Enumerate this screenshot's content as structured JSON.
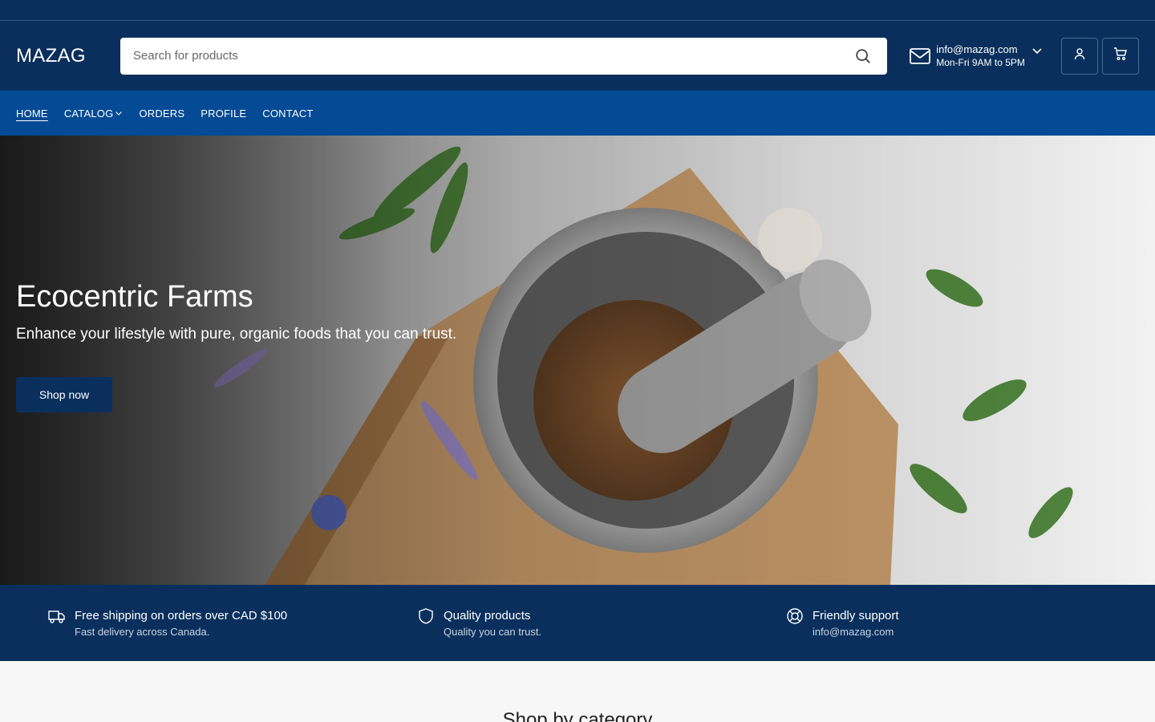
{
  "header": {
    "logo": "MAZAG",
    "search_placeholder": "Search for products",
    "contact_email": "info@mazag.com",
    "contact_hours": "Mon-Fri 9AM to 5PM"
  },
  "nav": {
    "items": [
      "HOME",
      "CATALOG",
      "ORDERS",
      "PROFILE",
      "CONTACT"
    ]
  },
  "hero": {
    "title": "Ecocentric Farms",
    "subtitle": "Enhance your lifestyle with pure, organic foods that you can trust.",
    "button": "Shop now"
  },
  "features": [
    {
      "title": "Free shipping on orders over CAD $100",
      "subtitle": "Fast delivery across Canada.",
      "icon": "truck-icon"
    },
    {
      "title": "Quality products",
      "subtitle": "Quality you can trust.",
      "icon": "shield-icon"
    },
    {
      "title": "Friendly support",
      "subtitle": "info@mazag.com",
      "icon": "lifebuoy-icon"
    }
  ],
  "section": {
    "heading": "Shop by category"
  },
  "colors": {
    "navy": "#0a2f5c",
    "nav_blue": "#054a94"
  }
}
